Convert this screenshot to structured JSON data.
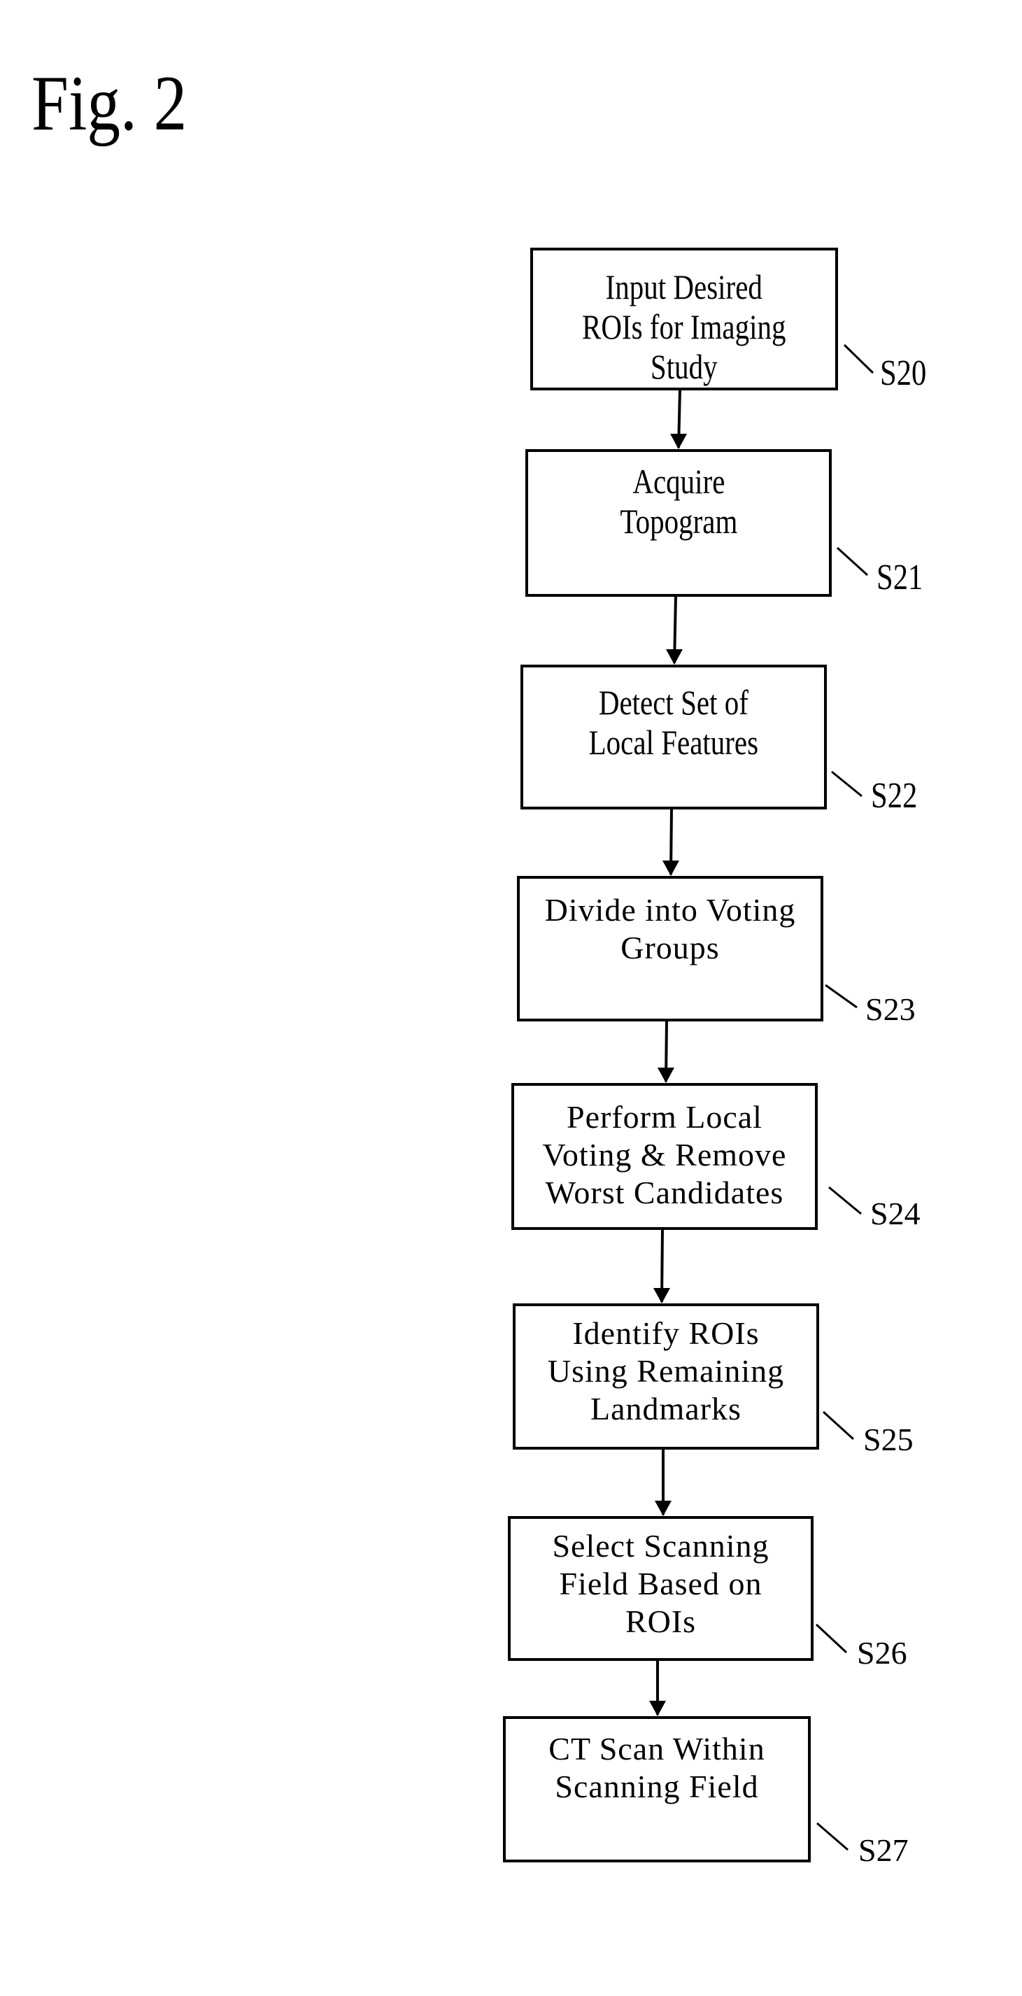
{
  "figure": {
    "title": "Fig. 2"
  },
  "steps": [
    {
      "id": "S20",
      "text": "Input Desired\nROIs for Imaging\nStudy"
    },
    {
      "id": "S21",
      "text": "Acquire\nTopogram"
    },
    {
      "id": "S22",
      "text": "Detect Set of\nLocal Features"
    },
    {
      "id": "S23",
      "text": "Divide into Voting\nGroups"
    },
    {
      "id": "S24",
      "text": "Perform Local\nVoting & Remove\nWorst Candidates"
    },
    {
      "id": "S25",
      "text": "Identify ROIs\nUsing Remaining\nLandmarks"
    },
    {
      "id": "S26",
      "text": "Select Scanning\nField Based on\nROIs"
    },
    {
      "id": "S27",
      "text": "CT Scan Within\nScanning Field"
    }
  ],
  "colors": {
    "ink": "#000000",
    "paper": "#ffffff"
  }
}
